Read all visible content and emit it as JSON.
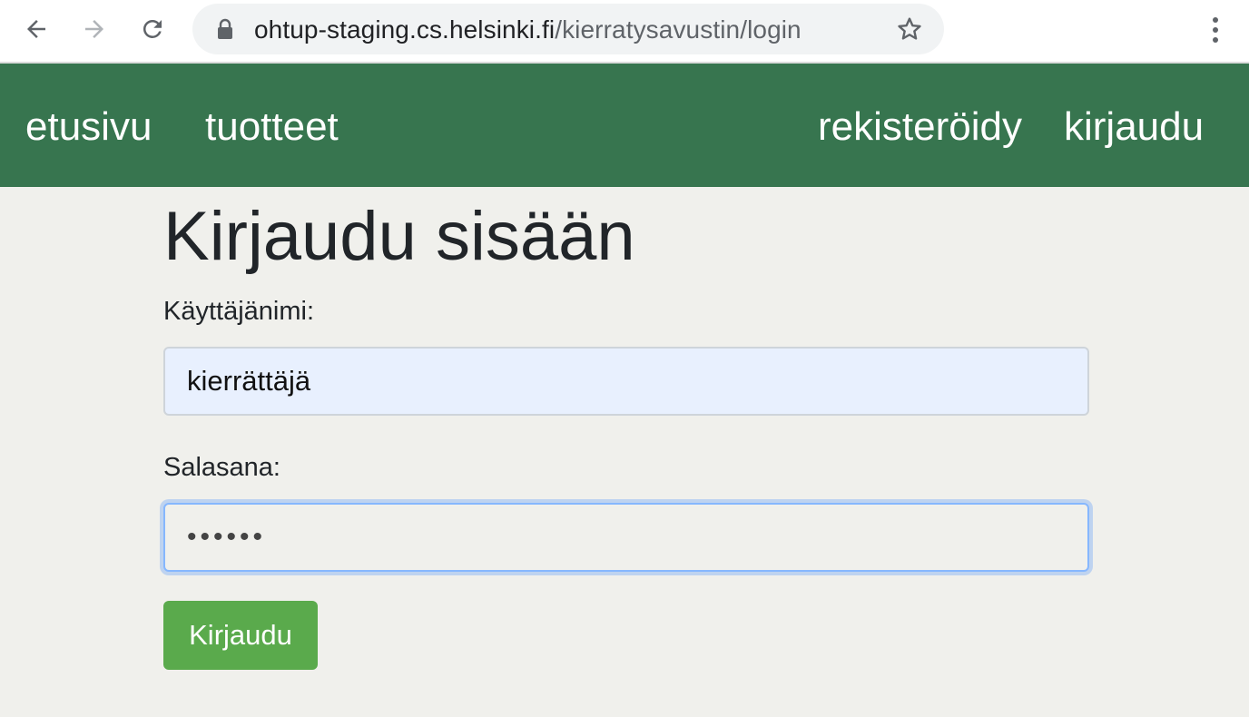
{
  "browser": {
    "url_host": "ohtup-staging.cs.helsinki.fi",
    "url_path": "/kierratysavustin/login"
  },
  "navbar": {
    "home": "etusivu",
    "products": "tuotteet",
    "register": "rekisteröidy",
    "login": "kirjaudu"
  },
  "form": {
    "title": "Kirjaudu sisään",
    "username_label": "Käyttäjänimi:",
    "username_value": "kierrättäjä",
    "password_label": "Salasana:",
    "password_value": "••••••",
    "submit_label": "Kirjaudu"
  },
  "colors": {
    "navbar_bg": "#37754f",
    "button_bg": "#5aaa4c",
    "page_bg": "#f0f0ec",
    "autofill_bg": "#e8f0fe"
  }
}
